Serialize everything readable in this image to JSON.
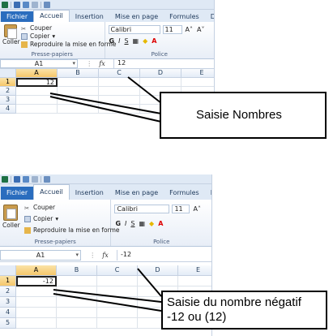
{
  "panels": [
    {
      "tabs": [
        "Fichier",
        "Accueil",
        "Insertion",
        "Mise en page",
        "Formules",
        "Données"
      ],
      "active_tab": "Accueil",
      "clipboard": {
        "paste": "Coller",
        "cut": "Couper",
        "copy": "Copier",
        "format_painter": "Reproduire la mise en forme",
        "label": "Presse-papiers"
      },
      "font": {
        "name": "Calibri",
        "size": "11",
        "label": "Police",
        "bold": "G",
        "italic": "I",
        "underline": "S"
      },
      "namebox": "A1",
      "fx": "fx",
      "formula_value": "12",
      "columns": [
        "A",
        "B",
        "C",
        "D",
        "E"
      ],
      "rows": [
        "1",
        "2",
        "3",
        "4"
      ],
      "cell_a1": "12"
    },
    {
      "tabs": [
        "Fichier",
        "Accueil",
        "Insertion",
        "Mise en page",
        "Formules",
        "Donn"
      ],
      "active_tab": "Accueil",
      "clipboard": {
        "paste": "Coller",
        "cut": "Couper",
        "copy": "Copier",
        "format_painter": "Reproduire la mise en forme",
        "label": "Presse-papiers"
      },
      "font": {
        "name": "Calibri",
        "size": "11",
        "label": "Police",
        "bold": "G",
        "italic": "I",
        "underline": "S"
      },
      "namebox": "A1",
      "fx": "fx",
      "formula_value": "-12",
      "columns": [
        "A",
        "B",
        "C",
        "D",
        "E"
      ],
      "rows": [
        "1",
        "2",
        "3",
        "4",
        "5"
      ],
      "cell_a1": "-12"
    }
  ],
  "callouts": {
    "first": "Saisie Nombres",
    "second_line1": "Saisie du nombre négatif",
    "second_line2": "-12 ou (12)"
  },
  "colors": {
    "file_tab": "#2a6dbe",
    "ribbon_bg": "#dfe9f5",
    "selection_header": "#f5c76b"
  }
}
